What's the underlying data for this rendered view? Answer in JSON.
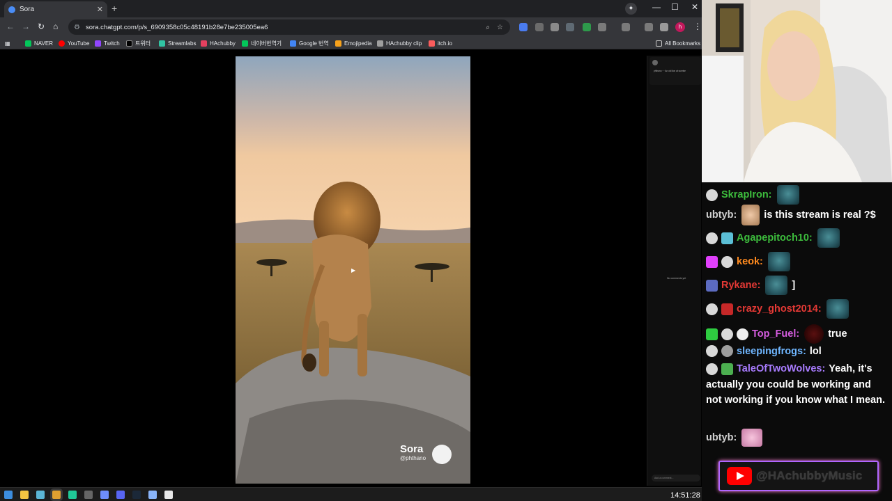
{
  "browser": {
    "tab": {
      "title": "Sora",
      "close": "✕"
    },
    "new_tab": "+",
    "window_controls": {
      "minimize": "—",
      "maximize": "☐",
      "close": "✕"
    },
    "nav": {
      "back": "←",
      "forward": "→",
      "reload": "↻",
      "home": "⌂"
    },
    "address": {
      "url": "sora.chatgpt.com/p/s_6909358c05c48191b28e7be235005ea6",
      "site_icon": "⚙",
      "zoom_icon": "⌕",
      "star_icon": "☆"
    },
    "profile_initial": "h",
    "bookmarks": [
      {
        "label": "NAVER",
        "color": "#03c75a"
      },
      {
        "label": "YouTube",
        "color": "#ff0000"
      },
      {
        "label": "Twitch",
        "color": "#9146ff"
      },
      {
        "label": "트위터",
        "color": "#000000"
      },
      {
        "label": "Streamlabs",
        "color": "#31c3a2"
      },
      {
        "label": "HAchubby",
        "color": "#e4405f"
      },
      {
        "label": "네이버번역기",
        "color": "#03c75a"
      },
      {
        "label": "Google 번역",
        "color": "#4285f4"
      },
      {
        "label": "Emojipedia",
        "color": "#f7a21b"
      },
      {
        "label": "HAchubby clip",
        "color": "#9e9e9e"
      },
      {
        "label": "itch.io",
        "color": "#fa5c5c"
      }
    ],
    "all_bookmarks": "All Bookmarks"
  },
  "video": {
    "watermark_name": "Sora",
    "watermark_handle": "@phthano"
  },
  "side_panel": {
    "post_text": "phthano ··· An old lion at sunrise",
    "no_comments": "No comments yet",
    "add_comment": "Add a comment..."
  },
  "taskbar": {
    "clock": "14:51:28"
  },
  "chat": [
    {
      "user": "SkrapIron:",
      "user_color": "#3dbd3d",
      "text": "",
      "emote": true,
      "badge_color": "#d8d8d8"
    },
    {
      "user": "ubtyb:",
      "user_color": "#d0d0d0",
      "text": "is this stream is real ?$",
      "emote_face": true
    },
    {
      "user": "Agapepitoch10:",
      "user_color": "#3dbd3d",
      "text": "",
      "emote": true,
      "badge_color": "#d8d8d8"
    },
    {
      "user": "keok:",
      "user_color": "#ff8a1e",
      "text": "",
      "emote": true,
      "badge_color": "#e040fb"
    },
    {
      "user": "Rykane:",
      "user_color": "#e53935",
      "text": "]",
      "emote": true,
      "badge_color": "#5c6bc0"
    },
    {
      "user": "crazy_ghost2014:",
      "user_color": "#e53935",
      "text": "",
      "emote": true,
      "badge_color": "#c62828"
    },
    {
      "user": "Top_Fuel:",
      "user_color": "#d65ce0",
      "text": "true",
      "badge_color": "#2ecc40"
    },
    {
      "user": "sleepingfrogs:",
      "user_color": "#6fb6ff",
      "text": "lol",
      "badge_color": "#9e9e9e"
    },
    {
      "user": "TaleOfTwoWolves:",
      "user_color": "#a97cff",
      "text": "Yeah, it's actually you could be working and not working if you know what I mean.",
      "badge_color": "#4caf50"
    },
    {
      "user": "ubtyb:",
      "user_color": "#d0d0d0",
      "text": "",
      "emote_pink": true
    }
  ],
  "youtube_handle": "@HAchubbyMusic"
}
